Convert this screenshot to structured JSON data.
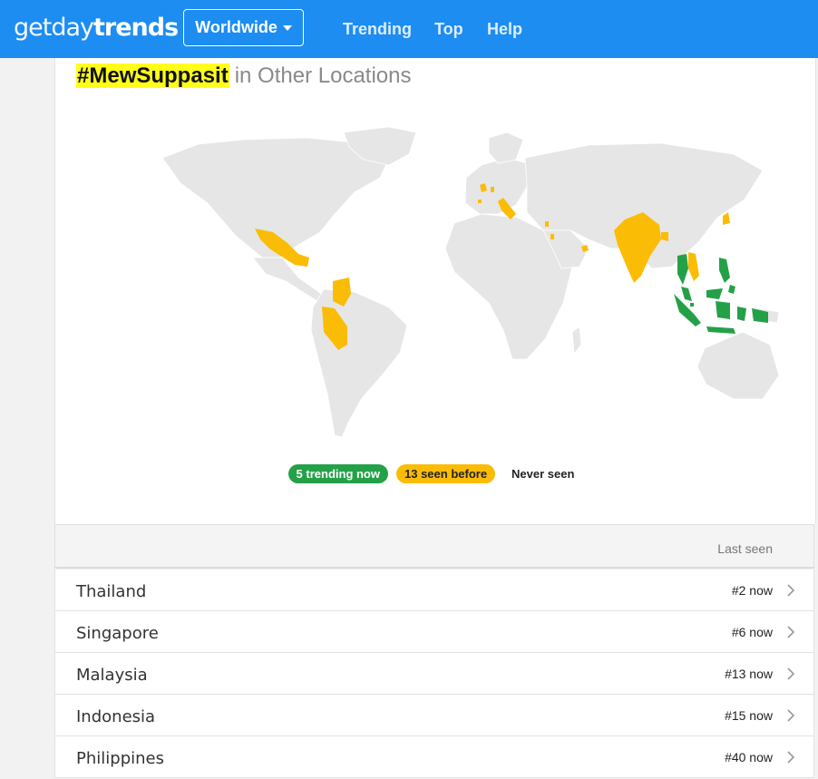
{
  "brand": {
    "part1": "getday",
    "part2": "trends"
  },
  "nav": {
    "region": "Worldwide",
    "links": [
      "Trending",
      "Top",
      "Help"
    ]
  },
  "section": {
    "hashtag": "#MewSuppasit",
    "subtitle": "in Other Locations"
  },
  "legend": {
    "now": "5 trending now",
    "before": "13 seen before",
    "never": "Never seen"
  },
  "colors": {
    "navbar": "#1d8df2",
    "trending_now": "#24a148",
    "seen_before": "#fbbc05",
    "never_seen": "#e6e6e6",
    "highlight": "#ffff1a"
  },
  "table": {
    "header": "Last seen",
    "rows": [
      {
        "country": "Thailand",
        "rank": "#2 now"
      },
      {
        "country": "Singapore",
        "rank": "#6 now"
      },
      {
        "country": "Malaysia",
        "rank": "#13 now"
      },
      {
        "country": "Indonesia",
        "rank": "#15 now"
      },
      {
        "country": "Philippines",
        "rank": "#40 now"
      }
    ]
  }
}
